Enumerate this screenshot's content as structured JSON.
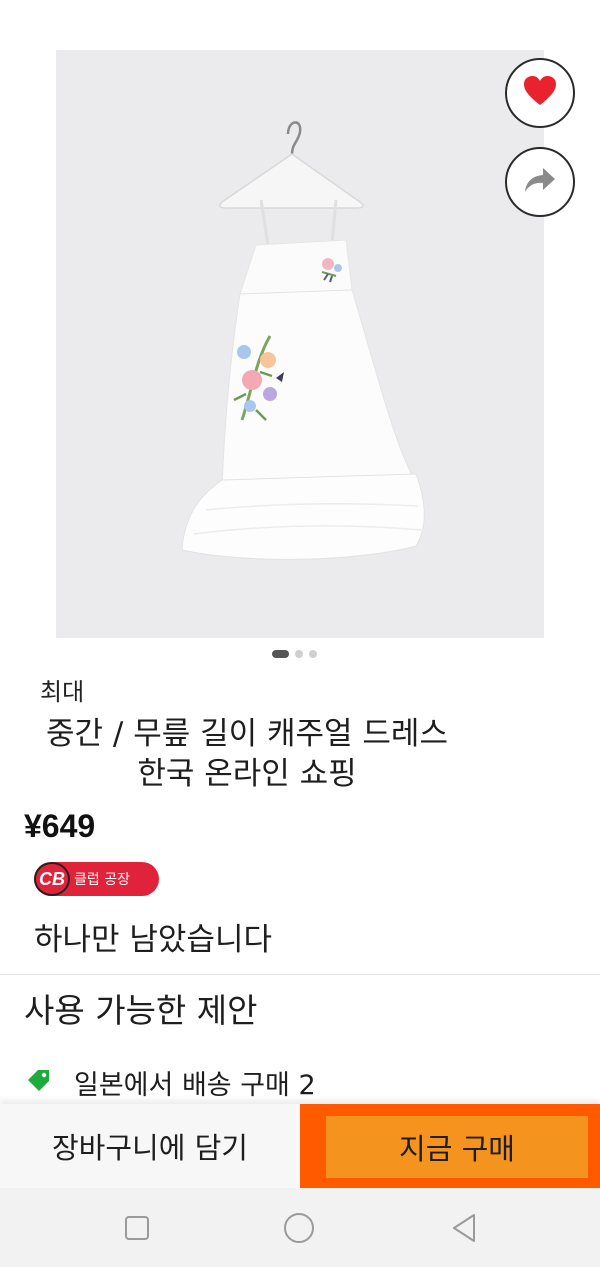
{
  "product": {
    "brand": "최대",
    "title": "중간 / 무릎 길이 캐주얼 드레스 한국 온라인 쇼핑",
    "price": "¥649",
    "badge_logo": "CB",
    "badge_text": "클럽 공장",
    "stock_note": "하나만 남았습니다",
    "image_count": 3,
    "active_image": 1
  },
  "actions": {
    "favorite_icon": "heart-icon",
    "share_icon": "share-arrow-icon"
  },
  "offers": {
    "heading": "사용 가능한 제안",
    "items": [
      {
        "icon": "tag-icon",
        "text": "일본에서 배송 구매 2"
      }
    ]
  },
  "bottom_bar": {
    "cart_label": "장바구니에 담기",
    "buy_label": "지금 구매"
  },
  "nav": {
    "recents_icon": "square-icon",
    "home_icon": "circle-icon",
    "back_icon": "triangle-back-icon"
  },
  "colors": {
    "heart": "#e8232e",
    "badge": "#e0233a",
    "buy_outer": "#ff5a00",
    "buy_inner": "#f4941e",
    "offer_tag": "#1faa3c"
  }
}
